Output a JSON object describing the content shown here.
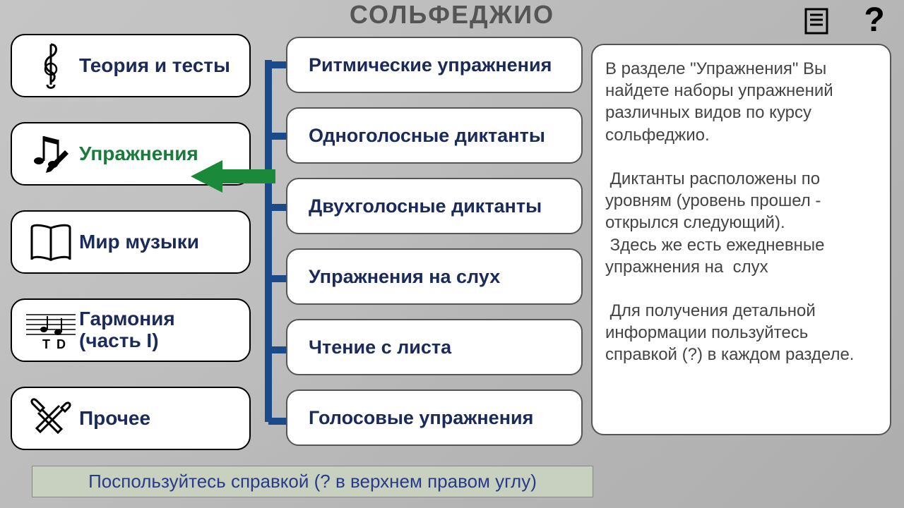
{
  "title": "СОЛЬФЕДЖИО",
  "icons": {
    "doc": "doc-icon",
    "help": "help-icon"
  },
  "menu": [
    {
      "label": "Теория и тесты"
    },
    {
      "label": "Упражнения"
    },
    {
      "label": "Мир музыки"
    },
    {
      "label": "Гармония (часть I)"
    },
    {
      "label": "Прочее"
    }
  ],
  "submenu": [
    {
      "label": "Ритмические упражнения"
    },
    {
      "label": "Одноголосные диктанты"
    },
    {
      "label": "Двухголосные диктанты"
    },
    {
      "label": "Упражнения на слух"
    },
    {
      "label": "Чтение с листа"
    },
    {
      "label": "Голосовые упражнения"
    }
  ],
  "info": "В разделе \"Упражнения\" Вы найдете наборы упражнений различных видов по курсу сольфеджио.\n\n Диктанты расположены по уровням (уровень прошел - открылся следующий).\n Здесь же есть ежедневные упражнения на  слух\n\n Для получения детальной информации пользуйтесь справкой (?) в каждом разделе.",
  "hint": "Поспользуйтесь справкой (? в верхнем правом углу)"
}
